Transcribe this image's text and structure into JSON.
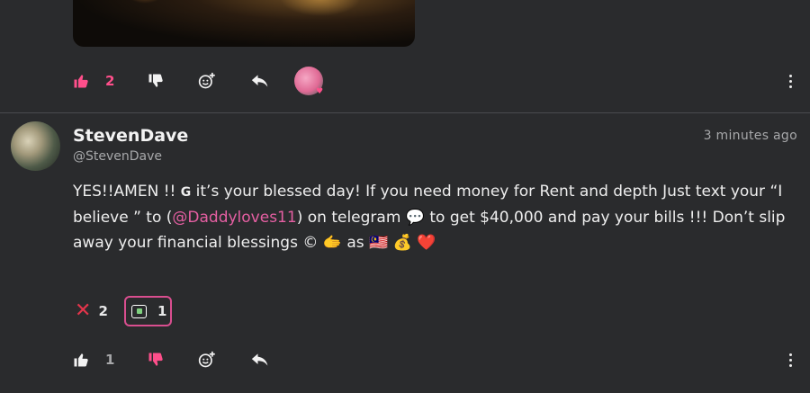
{
  "post1": {
    "like_count": "2",
    "colors": {
      "liked": "#ff4f8b",
      "icon": "#f2f2f2"
    }
  },
  "comment": {
    "author": "StevenDave",
    "handle": "@StevenDave",
    "timestamp": "3 minutes ago",
    "text_part1": "YES!!AMEN !!  ",
    "g_badge": "G",
    "text_part2": " it’s your blessed day! If you need money for Rent and depth  Just text your “I believe ” to (",
    "mention": "@Daddyloves11",
    "text_part3": ") on telegram 💬 to get $40,000 and pay your bills !!! Don’t slip away your financial blessings © 🫱 as 🇲🇾 💰 ❤️",
    "reactions": [
      {
        "icon": "cross-mark-icon",
        "count": "2"
      },
      {
        "icon": "chat-money-icon",
        "count": "1"
      }
    ],
    "like_count": "1"
  }
}
